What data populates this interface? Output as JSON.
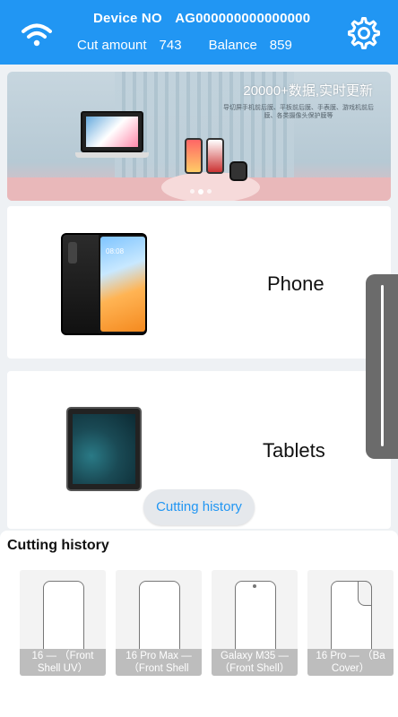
{
  "header": {
    "device_label": "Device NO",
    "device_no": "AG000000000000000",
    "cut_amount_label": "Cut amount",
    "cut_amount": "743",
    "balance_label": "Balance",
    "balance": "859",
    "color": "#2196f3"
  },
  "banner": {
    "title": "20000+数据,实时更新",
    "subtitle": "导切屏手机前后膜、平板前后膜、手表膜、游戏机前后膜、各类摄像头保护膜等",
    "slides": 3,
    "active_slide": 1
  },
  "categories": [
    {
      "label": "Phone"
    },
    {
      "label": "Tablets"
    }
  ],
  "history_button": "Cutting history",
  "history": {
    "title": "Cutting history",
    "items": [
      {
        "line1": "16 — （Front",
        "line2": "Shell UV）"
      },
      {
        "line1": "16 Pro Max —",
        "line2": "（Front Shell"
      },
      {
        "line1": "Galaxy M35 —",
        "line2": "（Front Shell）"
      },
      {
        "line1": "16 Pro — （Ba",
        "line2": "Cover）"
      }
    ]
  },
  "phone_screen_time": "08:08"
}
